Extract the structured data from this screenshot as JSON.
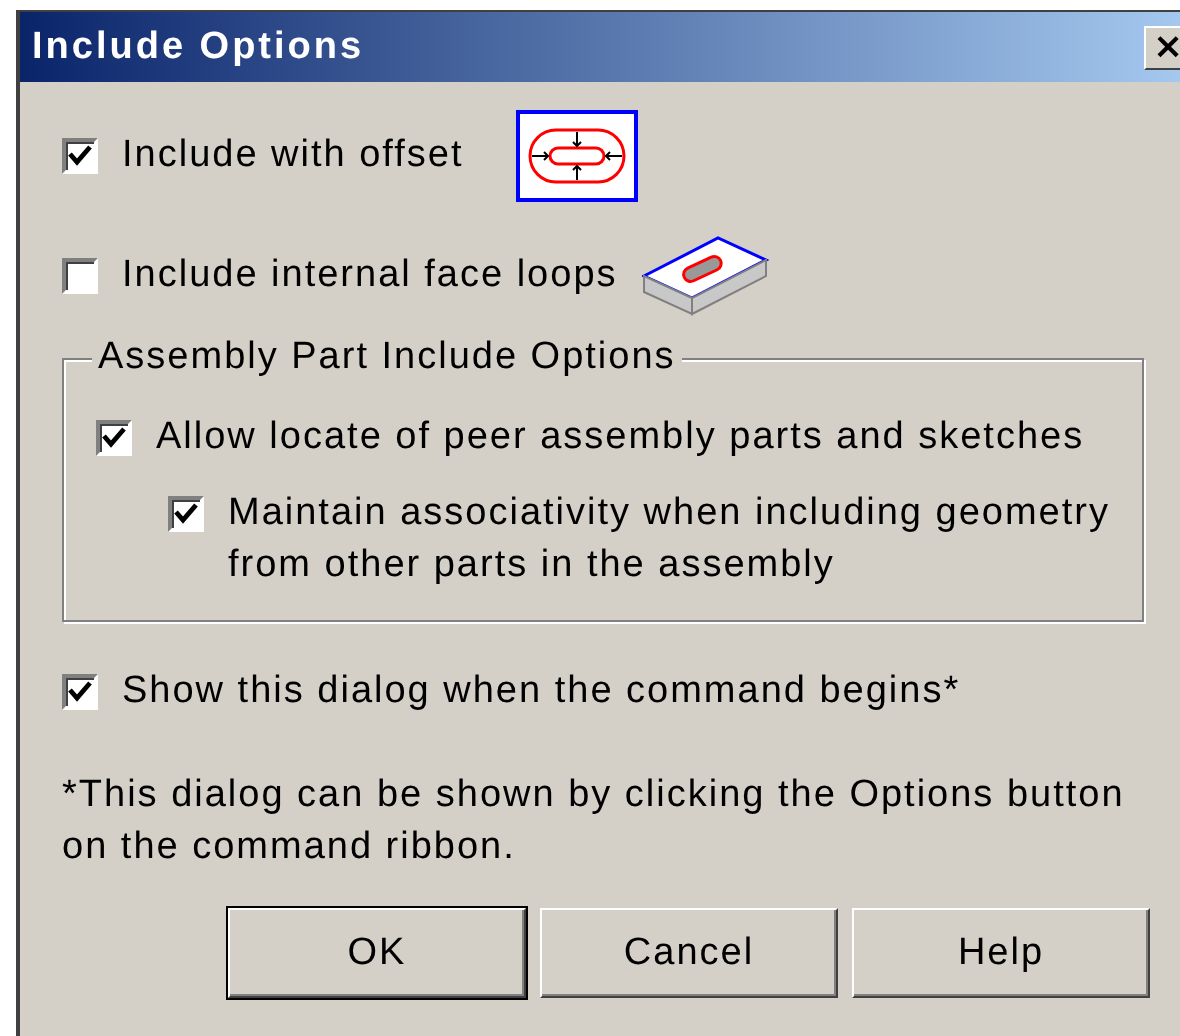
{
  "window": {
    "title": "Include Options",
    "close_label": "×"
  },
  "options": [
    {
      "label": "Include with offset",
      "checked": true,
      "kind": "offset"
    },
    {
      "label": "Include internal face loops",
      "checked": false,
      "kind": "face-loops"
    }
  ],
  "group": {
    "title": "Assembly Part Include Options",
    "options": [
      {
        "label": "Allow locate of peer assembly parts and sketches",
        "checked": true,
        "indented": false
      },
      {
        "label": "Maintain associativity when including geometry from other parts in the assembly",
        "checked": true,
        "indented": true
      }
    ]
  },
  "show_dialog": {
    "label": "Show this dialog when the command begins*",
    "checked": true
  },
  "note": "*This dialog can be shown by clicking the Options button on the command ribbon.",
  "buttons": [
    {
      "label": "OK",
      "default": true
    },
    {
      "label": "Cancel",
      "default": false
    },
    {
      "label": "Help",
      "default": false
    }
  ]
}
